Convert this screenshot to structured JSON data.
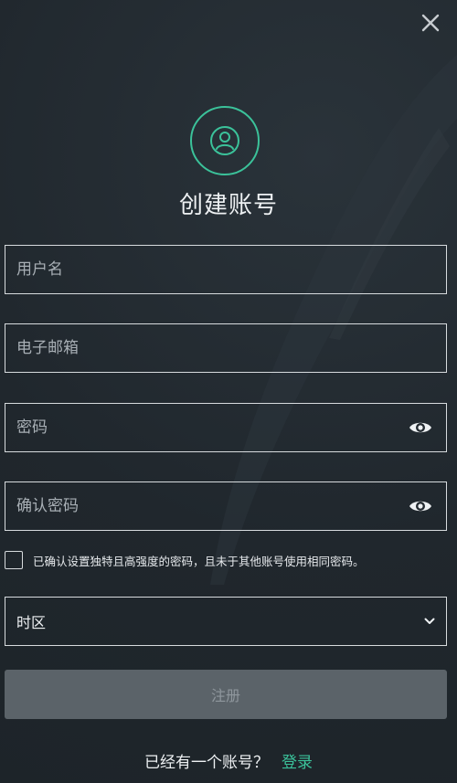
{
  "header": {
    "title": "创建账号",
    "close_icon": "close-icon",
    "avatar_icon": "user-icon"
  },
  "form": {
    "username": {
      "placeholder": "用户名",
      "value": ""
    },
    "email": {
      "placeholder": "电子邮箱",
      "value": ""
    },
    "password": {
      "placeholder": "密码",
      "value": "",
      "toggle_icon": "eye-icon"
    },
    "confirm_password": {
      "placeholder": "确认密码",
      "value": "",
      "toggle_icon": "eye-icon"
    },
    "consent": {
      "checked": false,
      "label": "已确认设置独特且高强度的密码，且未于其他账号使用相同密码。"
    },
    "timezone": {
      "label": "时区",
      "icon": "chevron-down-icon"
    },
    "register_label": "注册"
  },
  "footer": {
    "prompt": "已经有一个账号？",
    "login_label": "登录"
  },
  "colors": {
    "accent": "#3bc29a",
    "background": "#232a30",
    "button_disabled": "#5b6369"
  }
}
